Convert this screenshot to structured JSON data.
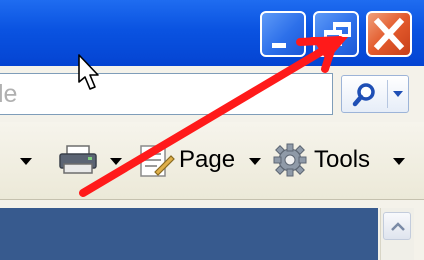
{
  "window": {
    "buttons": [
      {
        "name": "minimize",
        "icon": "minimize-icon"
      },
      {
        "name": "restore",
        "icon": "restore-icon"
      },
      {
        "name": "close",
        "icon": "close-icon"
      }
    ],
    "titlebar_color": "#0a53e1",
    "close_color": "#e35a2c"
  },
  "address_bar": {
    "partial_text": "le"
  },
  "search": {
    "icon": "search-icon",
    "dropdown_icon": "chevron-down-icon"
  },
  "command_bar": {
    "print_icon": "printer-icon",
    "page_icon": "page-icon",
    "page_label": "Page",
    "tools_icon": "gear-icon",
    "tools_label": "Tools"
  },
  "annotation": {
    "arrow_color": "#ff1a1a",
    "cursor": "mouse-pointer-icon"
  }
}
